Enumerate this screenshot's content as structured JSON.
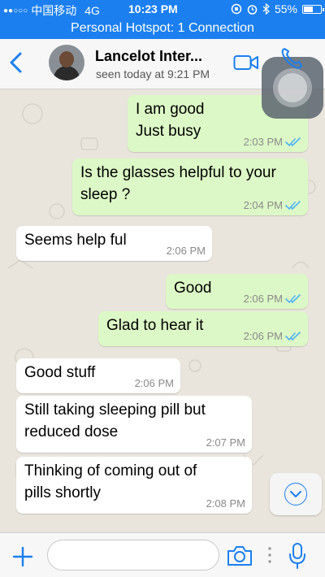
{
  "status_bar": {
    "signal": "●●○○○",
    "carrier": "中国移动",
    "network": "4G",
    "time": "10:23 PM",
    "battery_percent": "55%",
    "battery_level": 0.55
  },
  "hotspot": {
    "text": "Personal Hotspot: 1 Connection"
  },
  "header": {
    "back_icon": "chevron-left-icon",
    "contact_name": "Lancelot  Inter...",
    "last_seen": "seen today at 9:21 PM",
    "video_icon": "video-camera-icon",
    "call_icon": "phone-icon"
  },
  "messages": [
    {
      "direction": "out",
      "text": "I am good\nJust busy",
      "time": "2:03 PM",
      "status": "read"
    },
    {
      "direction": "out",
      "text": "Is the glasses helpful to your\nsleep ?",
      "time": "2:04 PM",
      "status": "read"
    },
    {
      "direction": "in",
      "text": "Seems help ful",
      "time": "2:06 PM"
    },
    {
      "direction": "out",
      "text": "Good",
      "time": "2:06 PM",
      "status": "read"
    },
    {
      "direction": "out",
      "text": "Glad to hear it",
      "time": "2:06 PM",
      "status": "read"
    },
    {
      "direction": "in",
      "text": "Good stuff",
      "time": "2:06 PM"
    },
    {
      "direction": "in",
      "text": "Still taking sleeping pill but\nreduced dose",
      "time": "2:07 PM"
    },
    {
      "direction": "in",
      "text": "Thinking of coming out of\npills shortly",
      "time": "2:08 PM"
    }
  ],
  "input_bar": {
    "plus_icon": "plus-icon",
    "message_placeholder": "",
    "camera_icon": "camera-icon",
    "mic_icon": "microphone-icon"
  },
  "colors": {
    "accent": "#1b7ff0",
    "outgoing_bubble": "#dcf8c6",
    "incoming_bubble": "#ffffff",
    "chat_background": "#e9e5dd",
    "read_ticks": "#4fb3f6"
  }
}
